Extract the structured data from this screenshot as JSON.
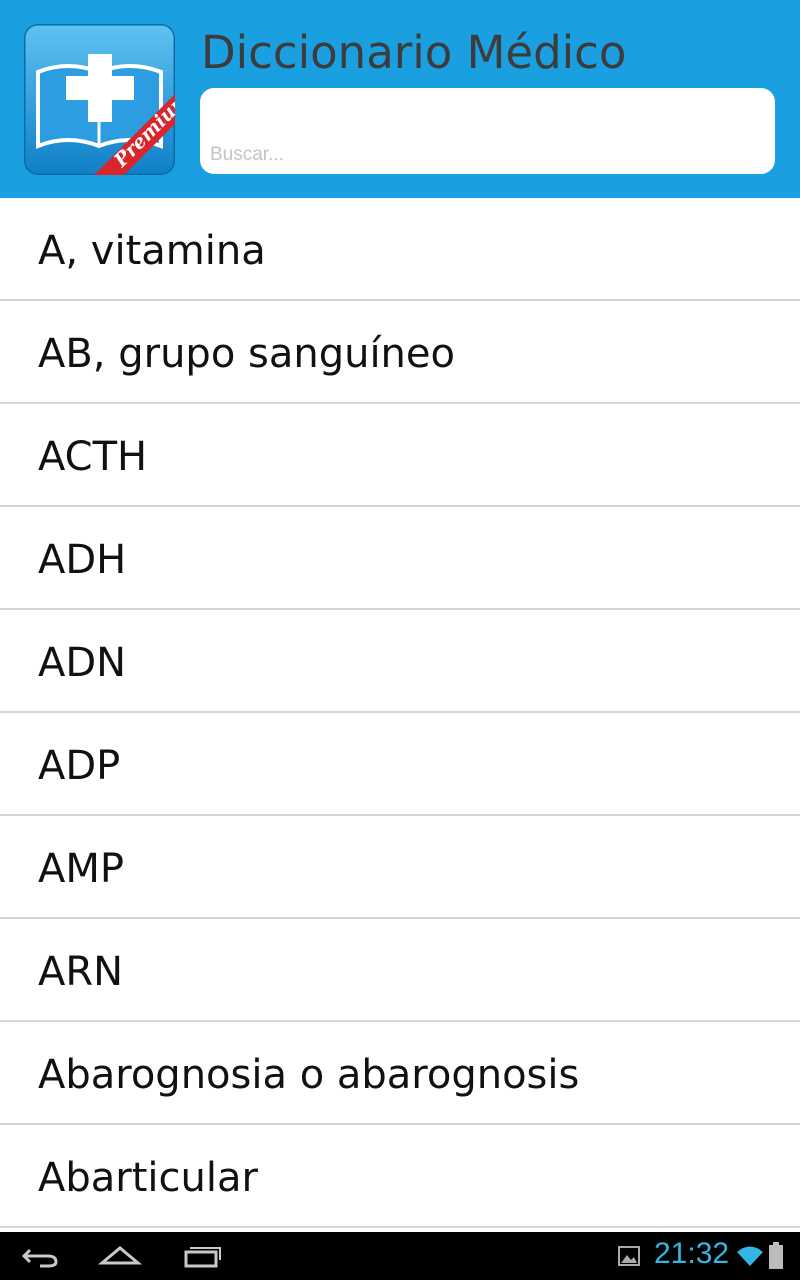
{
  "header": {
    "title": "Diccionario Médico",
    "icon_badge": "Premium",
    "search_placeholder": "Buscar..."
  },
  "entries": [
    "A, vitamina",
    "AB, grupo sanguíneo",
    "ACTH",
    "ADH",
    "ADN",
    "ADP",
    "AMP",
    "ARN",
    "Abarognosia o abarognosis",
    "Abarticular"
  ],
  "system_bar": {
    "time": "21:32",
    "icons": [
      "back-icon",
      "home-icon",
      "recent-apps-icon",
      "gallery-notification-icon",
      "wifi-icon",
      "battery-icon"
    ]
  },
  "colors": {
    "header_bg": "#1aa0e0",
    "title_text": "#3c3c3c",
    "clock": "#33b5e5",
    "divider": "#d6d6d6"
  }
}
